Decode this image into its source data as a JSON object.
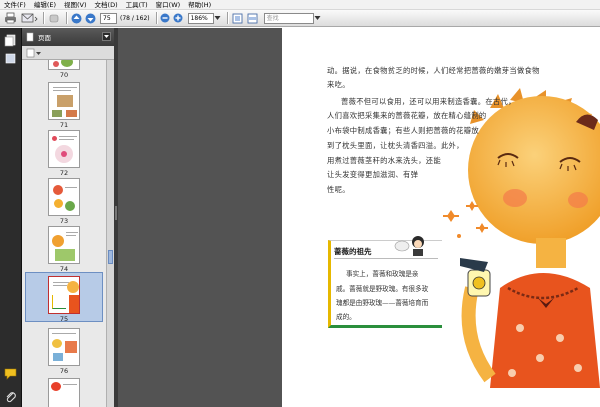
{
  "menu": [
    "文件(F)",
    "编辑(E)",
    "视图(V)",
    "文档(D)",
    "工具(T)",
    "窗口(W)",
    "帮助(H)"
  ],
  "toolbar": {
    "page_current": "75",
    "page_total": "(78 / 162)",
    "zoom": "186%",
    "search_placeholder": "查找"
  },
  "panel": {
    "title": "页面"
  },
  "thumbnails": [
    {
      "label": "70"
    },
    {
      "label": "71"
    },
    {
      "label": "72"
    },
    {
      "label": "73"
    },
    {
      "label": "74"
    },
    {
      "label": "75",
      "selected": true
    },
    {
      "label": "76"
    }
  ],
  "document": {
    "lines": [
      "动。据说，在食物贫乏的时候，人们经常把蔷薇的嫩芽当做食物",
      "来吃。",
      "蔷薇不但可以食用，还可以用来制造香囊。在古代，",
      "人们喜欢把采集来的蔷薇花瓣，放在精心缝制的",
      "小布袋中制成香囊；有些人则把蔷薇的花瓣放",
      "到了枕头里面，让枕头清香四溢。此外，",
      "用煮过蔷薇茎秆的水来洗头，还能",
      "让头发变得更加滋润、有弹",
      "性呢。"
    ],
    "box_title": "蔷薇的祖先",
    "box_lines": [
      "事实上，蔷薇和玫瑰是亲",
      "戚。蔷薇就是野玫瑰。有很多玫",
      "瑰都是由野玫瑰——蔷薇培育而",
      "成的。"
    ]
  },
  "colors": {
    "accent_yellow": "#e6b800",
    "accent_green": "#2a8f3c",
    "character_skin": "#f5b342",
    "dress_orange": "#e8541e",
    "selection_blue": "#b7cbe7"
  }
}
